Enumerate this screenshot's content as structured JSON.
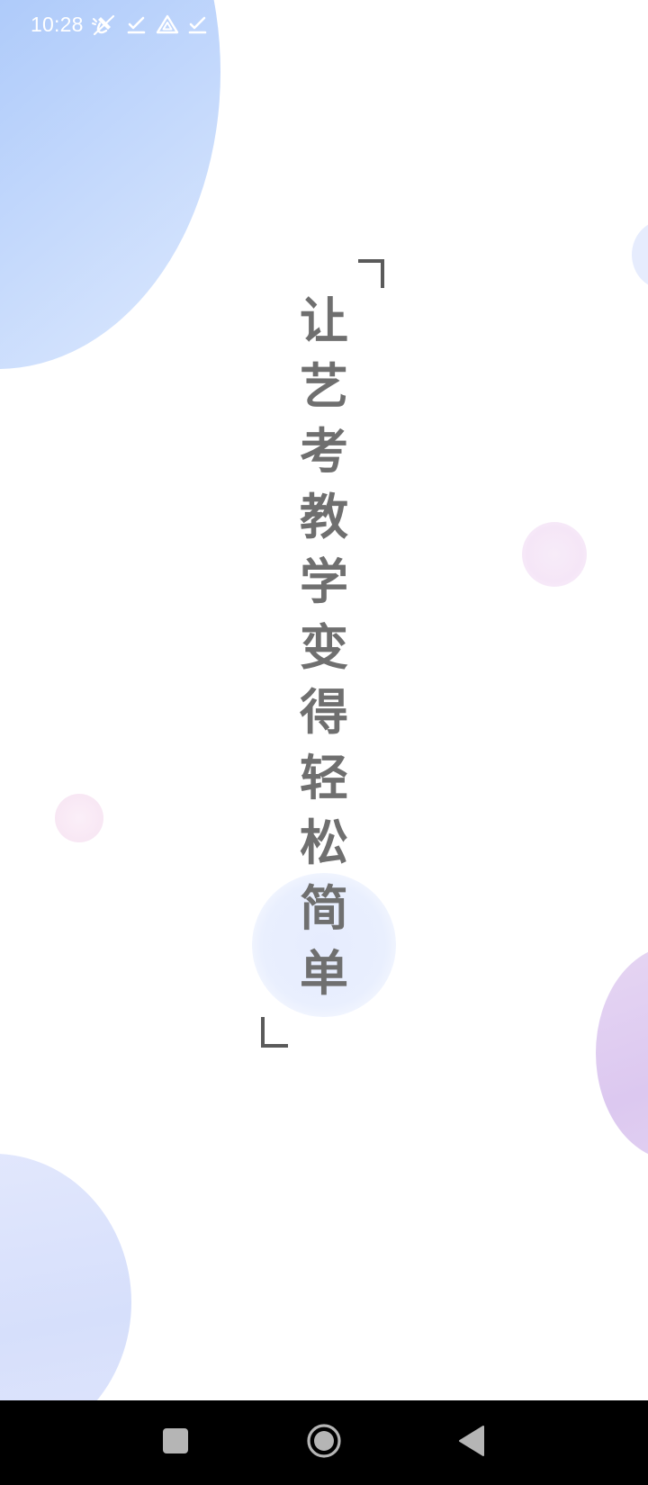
{
  "status_bar": {
    "time": "10:28",
    "icons": [
      "mute-vibrate-off-icon",
      "check-icon",
      "drive-icon",
      "check-icon"
    ]
  },
  "slogan": {
    "text": "让艺考教学变得轻松简单"
  },
  "nav_bar": {
    "buttons": [
      "recents-square-icon",
      "home-circle-icon",
      "back-triangle-icon"
    ]
  },
  "colors": {
    "slogan_text": "#6f6f6f",
    "bracket": "#5a5a5a",
    "accent_blue": "#8fb6f7",
    "accent_purple": "#dcc8f0",
    "nav_background": "#000000"
  }
}
